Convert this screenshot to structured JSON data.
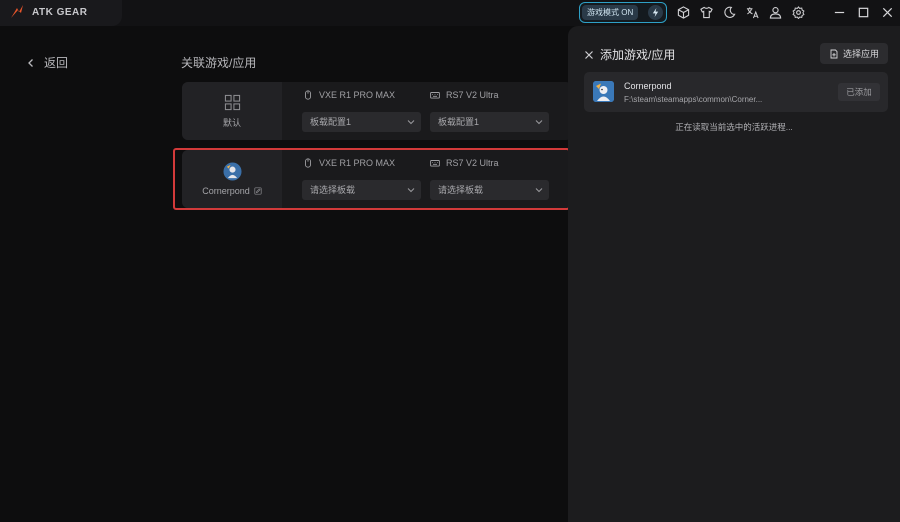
{
  "app": {
    "brand": "ATK GEAR",
    "accent_color": "#e8552a"
  },
  "titlebar": {
    "game_mode_label": "游戏模式 ON",
    "icons": [
      "cube-icon",
      "shirt-icon",
      "moon-icon",
      "translate-icon",
      "user-icon",
      "gear-icon"
    ],
    "window_controls": [
      "minimize-icon",
      "maximize-icon",
      "close-icon"
    ]
  },
  "main": {
    "back_label": "返回",
    "section_title": "关联游戏/应用",
    "rows": [
      {
        "app_label": "默认",
        "devices": [
          {
            "name": "VXE R1 PRO MAX",
            "icon": "mouse-icon",
            "selected": "板载配置1"
          },
          {
            "name": "RS7 V2 Ultra",
            "icon": "keyboard-icon",
            "selected": "板载配置1"
          }
        ]
      },
      {
        "app_label": "Cornerpond",
        "devices": [
          {
            "name": "VXE R1 PRO MAX",
            "icon": "mouse-icon",
            "selected": "请选择板载"
          },
          {
            "name": "RS7 V2 Ultra",
            "icon": "keyboard-icon",
            "selected": "请选择板载"
          }
        ]
      }
    ]
  },
  "panel": {
    "title": "添加游戏/应用",
    "choose_app_label": "选择应用",
    "apps": [
      {
        "name": "Cornerpond",
        "path": "F:\\steam\\steamapps\\common\\Corner...",
        "status": "已添加"
      }
    ],
    "reading_text": "正在读取当前选中的活跃进程..."
  }
}
